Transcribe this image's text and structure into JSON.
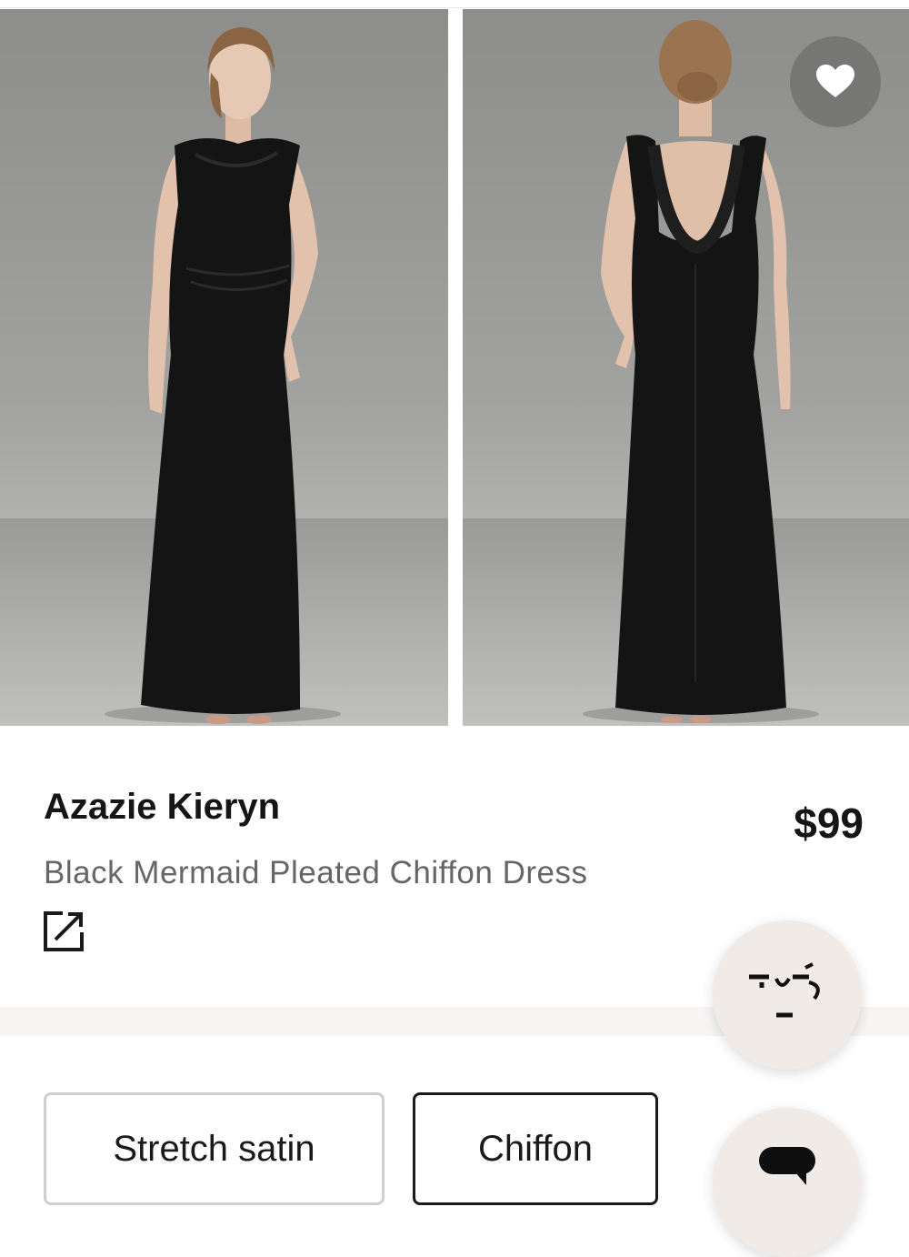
{
  "product": {
    "brand": "Azazie Kieryn",
    "subtitle": "Black Mermaid Pleated Chiffon Dress",
    "price": "$99"
  },
  "gallery": {
    "images": [
      {
        "name": "front-view",
        "dress_color": "#141414"
      },
      {
        "name": "back-view",
        "dress_color": "#141414"
      }
    ],
    "favorite_icon": "heart-icon"
  },
  "actions": {
    "share_icon": "open-external-icon",
    "assistant_icon": "face-icon",
    "chat_icon": "chat-bubble-icon"
  },
  "fabric_options": [
    {
      "label": "Stretch satin",
      "selected": false
    },
    {
      "label": "Chiffon",
      "selected": true
    }
  ],
  "colors": {
    "text_primary": "#151515",
    "text_secondary": "#666666",
    "fab_background": "#f1ebe8",
    "selected_border": "#1a1a1a",
    "unselected_border": "#cfcfcf"
  }
}
